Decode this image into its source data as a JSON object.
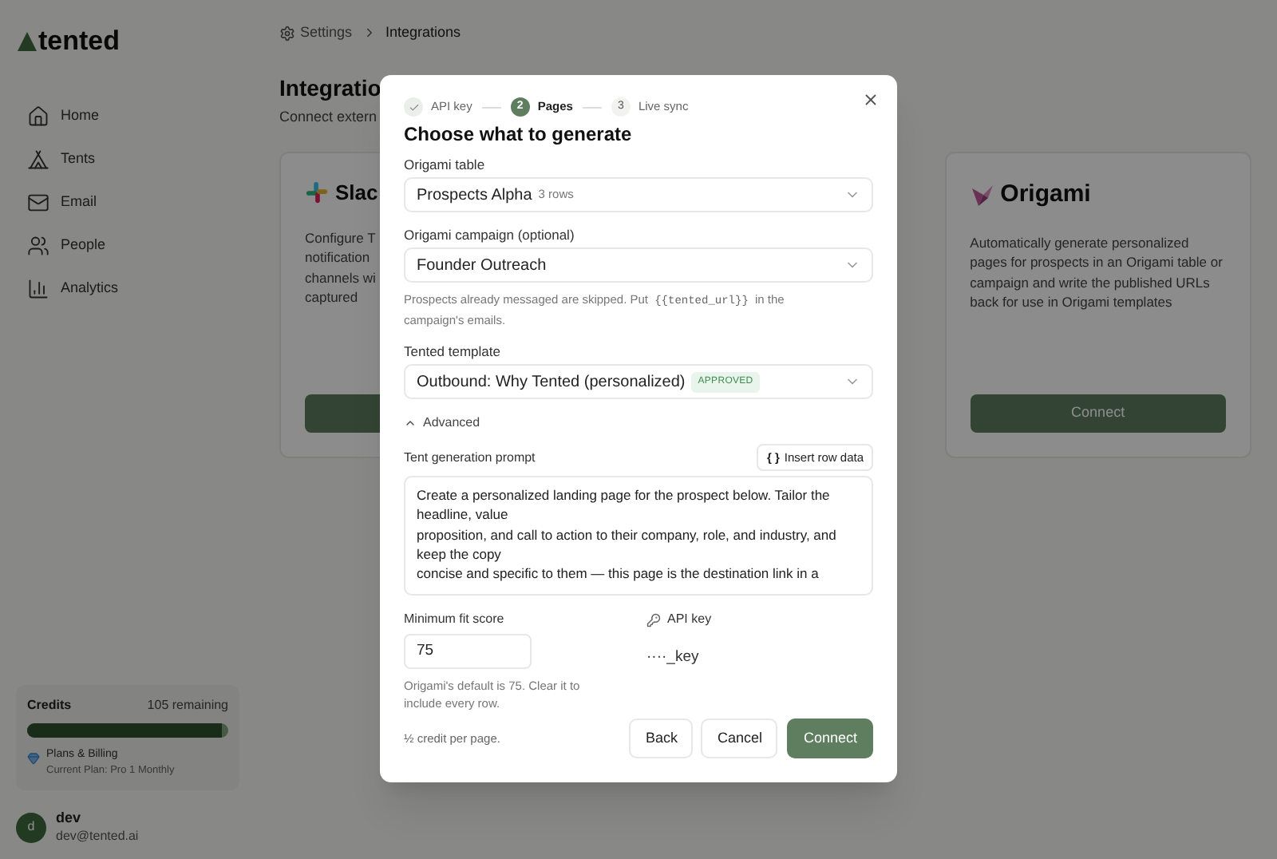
{
  "brand": {
    "name": "tented"
  },
  "sidebar": {
    "items": [
      {
        "label": "Home",
        "selected": false
      },
      {
        "label": "Tents",
        "selected": false
      },
      {
        "label": "Email",
        "selected": false
      },
      {
        "label": "People",
        "selected": false
      },
      {
        "label": "Analytics",
        "selected": false
      }
    ],
    "credits": {
      "label": "Credits",
      "remaining": "105 remaining",
      "level": 0.97
    },
    "plan": {
      "title": "Plans & Billing",
      "subtitle": "Current Plan: Pro 1 Monthly"
    },
    "user": {
      "initial": "d",
      "name": "dev",
      "email": "dev@tented.ai"
    }
  },
  "breadcrumb": [
    "Settings",
    "Integrations"
  ],
  "page": {
    "title": "Integratio",
    "subtitle": "Connect extern"
  },
  "cards": [
    {
      "kind": "slack",
      "name": "Slac",
      "description": [
        "Configure T",
        "notification",
        "channels wi",
        "captured"
      ]
    },
    {
      "kind": "origami",
      "name": "Origami",
      "description": [
        "Automatically generate personalized pages for prospects in an Origami table or campaign and write the published URLs back for use in Origami templates"
      ],
      "button": "Connect"
    }
  ],
  "dialog": {
    "steps": [
      {
        "label": "API key",
        "done": true,
        "selected": false
      },
      {
        "number": "2",
        "label": "Pages",
        "done": false,
        "selected": true
      },
      {
        "number": "3",
        "label": "Live sync",
        "done": false,
        "selected": false
      }
    ],
    "title": "Choose what to generate",
    "table": {
      "label": "Origami table",
      "value": "Prospects Alpha",
      "meta": "3 rows"
    },
    "campaign": {
      "label": "Origami campaign (optional)",
      "value": "Founder Outreach",
      "hint_before": "Prospects already messaged are skipped. Put",
      "hint_code": "{{tented_url}}",
      "hint_after": "in the campaign's emails."
    },
    "template": {
      "label": "Tented template",
      "value": "Outbound: Why Tented (personalized)",
      "badge": "APPROVED"
    },
    "advanced": {
      "label": "Advanced",
      "expanded": true
    },
    "prompt": {
      "label": "Tent generation prompt",
      "insert_button": "Insert row data",
      "insert_icon": "{ }",
      "value": "Create a personalized landing page for the prospect below. Tailor the headline, value\nproposition, and call to action to their company, role, and industry, and keep the copy\nconcise and specific to them — this page is the destination link in a"
    },
    "fit": {
      "label": "Minimum fit score",
      "value": "75",
      "hint": "Origami's default is 75. Clear it to include every row."
    },
    "api_key": {
      "label": "API key",
      "value": "····_key"
    },
    "footer_note": "½ credit per page.",
    "buttons": [
      {
        "label": "Back",
        "kind": "secondary"
      },
      {
        "label": "Cancel",
        "kind": "secondary"
      },
      {
        "label": "Connect",
        "kind": "primary"
      }
    ]
  }
}
